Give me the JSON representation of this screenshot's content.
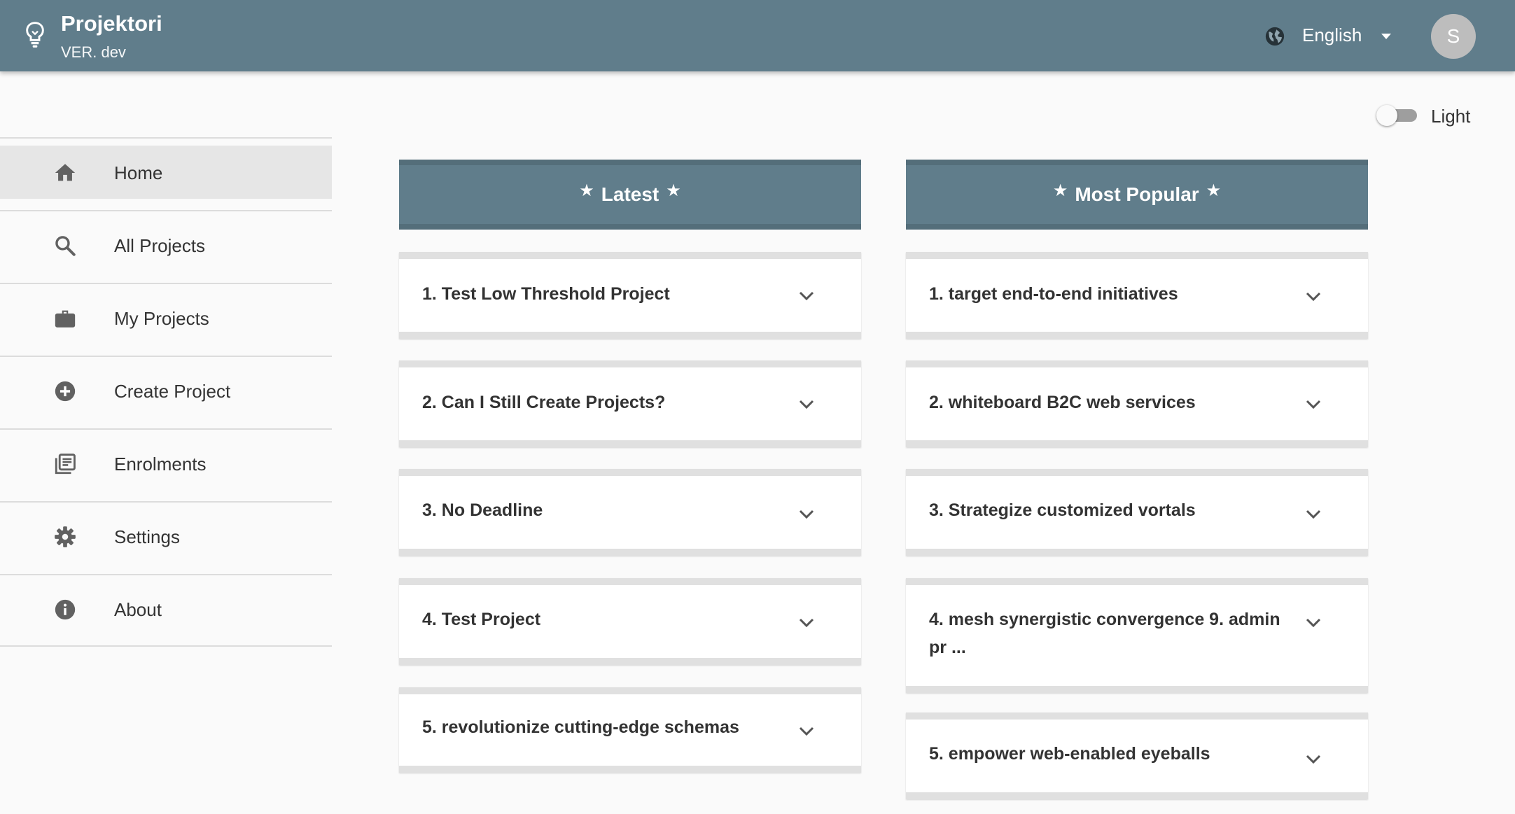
{
  "app": {
    "title": "Projektori",
    "version": "VER. dev",
    "language": "English",
    "avatar_initial": "S"
  },
  "theme_toggle": {
    "label": "Light",
    "enabled": false
  },
  "sidebar": {
    "items": [
      {
        "label": "Home",
        "icon": "home-icon",
        "active": true
      },
      {
        "label": "All Projects",
        "icon": "search-icon",
        "active": false
      },
      {
        "label": "My Projects",
        "icon": "briefcase-icon",
        "active": false
      },
      {
        "label": "Create Project",
        "icon": "add-circle-icon",
        "active": false
      },
      {
        "label": "Enrolments",
        "icon": "library-books-icon",
        "active": false
      },
      {
        "label": "Settings",
        "icon": "gear-icon",
        "active": false
      },
      {
        "label": "About",
        "icon": "info-icon",
        "active": false
      }
    ]
  },
  "latest": {
    "title": "Latest",
    "items": [
      "1. Test Low Threshold Project",
      "2. Can I Still Create Projects?",
      "3. No Deadline",
      "4. Test Project",
      "5. revolutionize cutting-edge schemas"
    ]
  },
  "popular": {
    "title": "Most Popular",
    "items": [
      "1. target end-to-end initiatives",
      "2. whiteboard B2C web services",
      "3. Strategize customized vortals",
      "4. mesh synergistic convergence 9. admin pr ...",
      "5. empower web-enabled eyeballs"
    ]
  },
  "colors": {
    "primary": "#607d8b",
    "primary_dark": "#546e7a",
    "background": "#fafafa",
    "active_nav": "#e6e6e6"
  }
}
